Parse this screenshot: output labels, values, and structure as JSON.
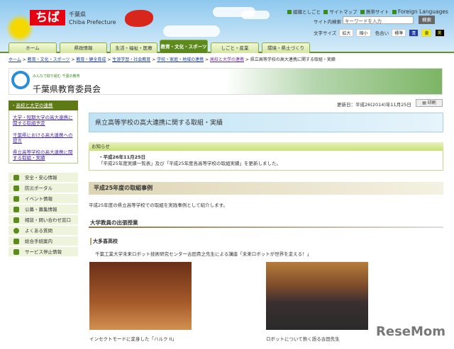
{
  "header": {
    "logo": "ちば",
    "pref_ja": "千葉県",
    "pref_en": "Chiba Prefecture",
    "links": [
      "組織としごと",
      "サイトマップ",
      "携帯サイト",
      "Foreign Languages"
    ],
    "search_label": "サイト内検索",
    "search_placeholder": "キーワードを入力",
    "search_button": "検索",
    "font_size_label": "文字サイズ",
    "font_large": "拡大",
    "font_small": "縮小",
    "color_label": "色合い",
    "color_standard": "標準",
    "color_blue": "青",
    "color_yellow": "黄",
    "color_black": "黒"
  },
  "tabs": [
    "ホーム",
    "県政情報",
    "生活・福祉・医療",
    "教育・文化・スポーツ",
    "しごと・産業",
    "環境・県土づくり"
  ],
  "breadcrumb": [
    "ホーム",
    "教育・文化・スポーツ",
    "教育・健全育成",
    "生涯学習・社会教育",
    "学校・家庭・地域の連携",
    "高校と大学の連携",
    "県立高等学校の高大連携に関する取組・実績"
  ],
  "banner": {
    "subtitle": "みんなで取り組む 千葉の教育",
    "title": "千葉県教育委員会"
  },
  "sidebar": {
    "heading": "高校と大学の連携",
    "links": [
      "大学・短期大学の高大連携に関する取組予定",
      "千葉県における高大連携への提言",
      "県立高等学校の高大連携に関する取組・実績"
    ],
    "menu": [
      "安全・安心情報",
      "防災ポータル",
      "イベント情報",
      "公募・募集情報",
      "相談・問い合わせ窓口",
      "よくある質問",
      "総合手続案内",
      "サービス停止情報"
    ]
  },
  "main": {
    "updated": "更新日：平成26(2014)年11月25日",
    "print": "印刷",
    "title": "県立高等学校の高大連携に関する取組・実績",
    "notice_heading": "お知らせ",
    "notice_date": "平成26年11月25日",
    "notice_text": "「平成25年度実績一覧表」及び「平成25年度各高等学校の取組実績」を更新しました。",
    "section_heading": "平成25年度の取組事例",
    "section_text": "平成25年度の県立高等学校での取組を実践事例として紹介します。",
    "h3": "大学教員の出張授業",
    "school": "大多喜高校",
    "desc": "千葉工業大学未来ロボット技術研究センター古田貴之先生による講座「未来ロボットが世界を変える！」",
    "caption1": "インセクトモードに変身した「ハルク II」",
    "caption2": "ロボットについて熱く語る古田先生"
  },
  "watermark": "ReseMom"
}
